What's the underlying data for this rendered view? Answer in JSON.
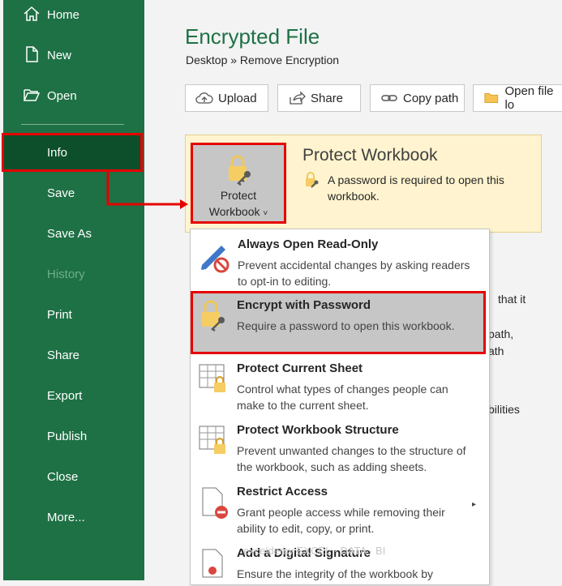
{
  "sidebar": {
    "items": [
      {
        "label": "Home",
        "icon": "home-icon"
      },
      {
        "label": "New",
        "icon": "new-file-icon"
      },
      {
        "label": "Open",
        "icon": "folder-icon"
      },
      {
        "label": "Info"
      },
      {
        "label": "Save"
      },
      {
        "label": "Save As"
      },
      {
        "label": "History",
        "disabled": true
      },
      {
        "label": "Print"
      },
      {
        "label": "Share"
      },
      {
        "label": "Export"
      },
      {
        "label": "Publish"
      },
      {
        "label": "Close"
      },
      {
        "label": "More..."
      }
    ],
    "selected": "Info"
  },
  "header": {
    "title": "Encrypted File",
    "breadcrumb": "Desktop » Remove Encryption"
  },
  "toolbar": {
    "upload": "Upload",
    "share": "Share",
    "copy_path": "Copy path",
    "open_file_location": "Open file lo"
  },
  "protect": {
    "button_line1": "Protect",
    "button_line2": "Workbook",
    "chevron": "˅",
    "heading": "Protect Workbook",
    "description": "A password is required to open this workbook."
  },
  "background_fragments": {
    "frag1": "that it",
    "frag2": "path,",
    "frag3": "ath",
    "frag4": "bilities"
  },
  "menu": {
    "items": [
      {
        "title": "Always Open Read-Only",
        "desc": "Prevent accidental changes by asking readers to opt-in to editing.",
        "icon": "pencil-no-icon"
      },
      {
        "title": "Encrypt with Password",
        "desc": "Require a password to open this workbook.",
        "icon": "lock-key-icon",
        "highlighted": true
      },
      {
        "title": "Protect Current Sheet",
        "desc": "Control what types of changes people can make to the current sheet.",
        "icon": "sheet-lock-icon"
      },
      {
        "title": "Protect Workbook Structure",
        "desc": "Prevent unwanted changes to the structure of the workbook, such as adding sheets.",
        "icon": "workbook-lock-icon"
      },
      {
        "title": "Restrict Access",
        "desc": "Grant people access while removing their ability to edit, copy, or print.",
        "icon": "restrict-access-icon",
        "has_submenu": true
      },
      {
        "title": "Add a Digital Signature",
        "desc": "Ensure the integrity of the workbook by",
        "icon": "signature-icon"
      }
    ]
  },
  "watermark": "exceldemy  EXCEL · DATA · BI",
  "colors": {
    "sidebar": "#1e7145",
    "highlight_border": "#e60000",
    "panel_bg": "#fff4cf"
  }
}
